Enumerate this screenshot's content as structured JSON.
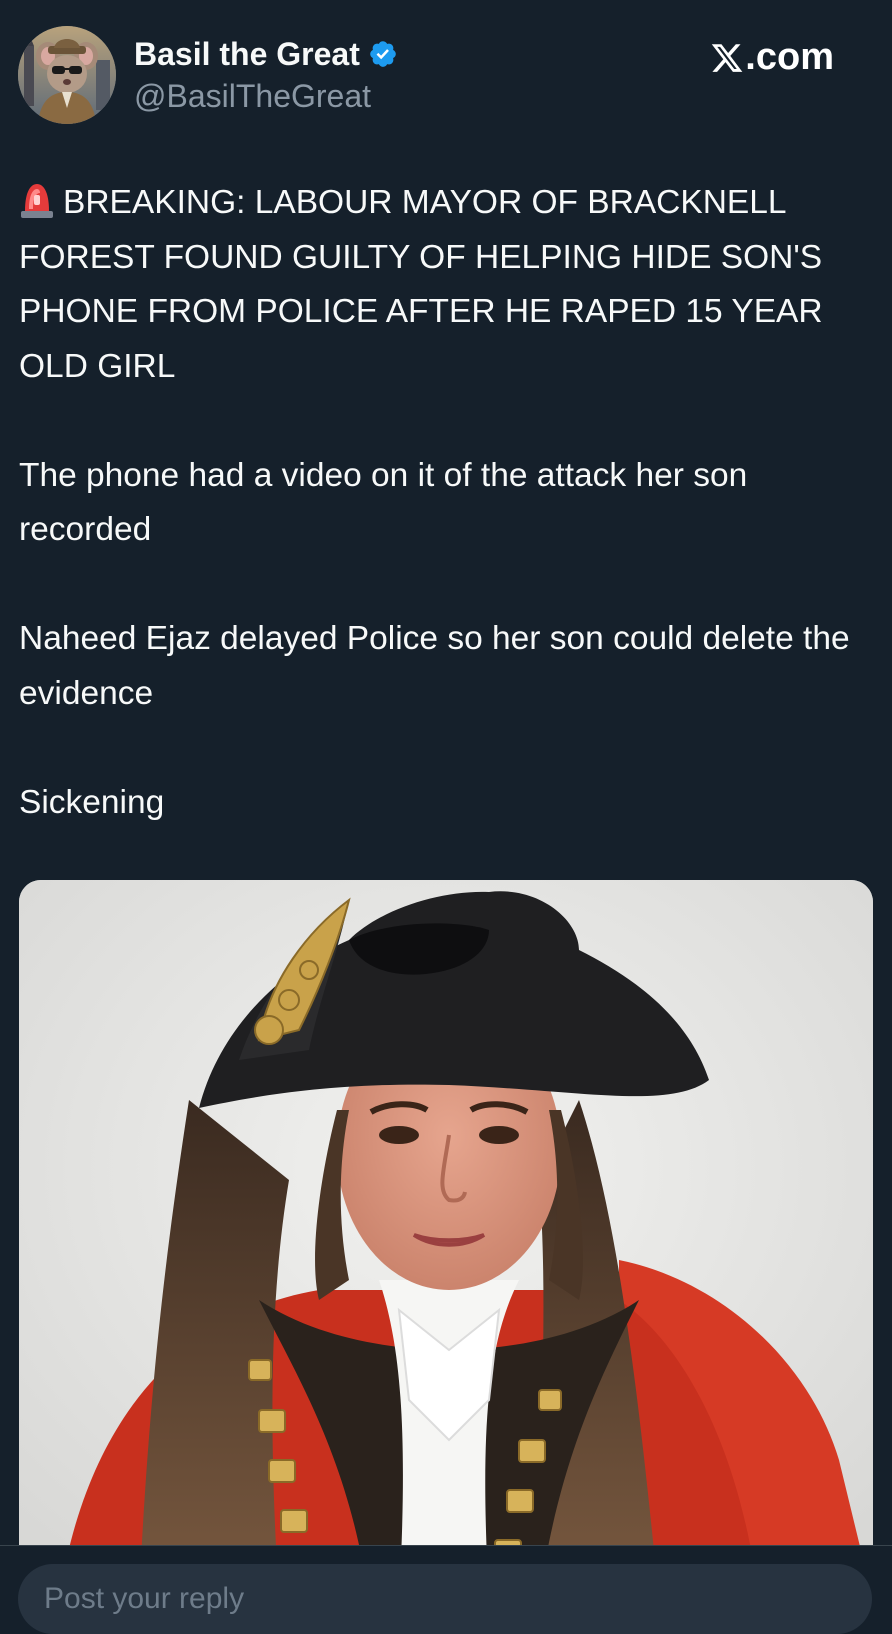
{
  "author": {
    "display_name": "Basil the Great",
    "handle": "@BasilTheGreat",
    "verified": true,
    "avatar_icon": "mouse-detective-avatar"
  },
  "brand": {
    "logo_icon": "x-logo-icon",
    "text": ".com"
  },
  "post": {
    "headline_icon": "siren-emoji",
    "headline": "BREAKING: LABOUR MAYOR OF BRACKNELL FOREST FOUND GUILTY OF HELPING HIDE SON'S PHONE FROM POLICE AFTER HE RAPED 15 YEAR OLD GIRL",
    "paragraphs": [
      "The phone had a video on it of the attack her son recorded",
      "Naheed Ejaz delayed Police so her son could delete the evidence",
      "Sickening"
    ],
    "media": {
      "type": "photo",
      "subject": "portrait-photo"
    }
  },
  "reply": {
    "placeholder": "Post your reply"
  },
  "colors": {
    "background": "#15202b",
    "text": "#f7f9f9",
    "secondary_text": "#8b98a5",
    "verified": "#1d9bf0",
    "input_bg": "#273340"
  }
}
